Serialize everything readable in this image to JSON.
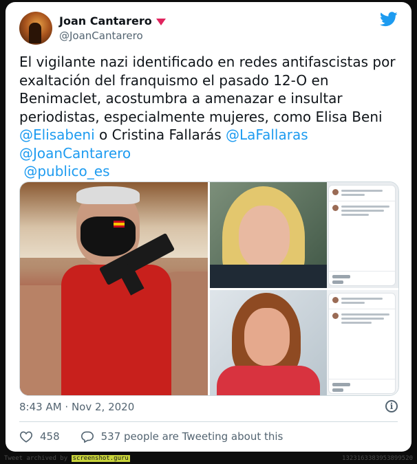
{
  "tweet": {
    "author_name": "Joan Cantarero",
    "author_handle": "@JoanCantarero",
    "text_plain": "El vigilante nazi identificado en redes antifascistas por exaltación del franquismo el pasado 12-O en Benimaclet, acostumbra a amenazar e insultar periodistas, especialmente mujeres, como Elisa Beni ",
    "mention_1": "@Elisabeni",
    "text_mid": " o Cristina Fallarás ",
    "mention_2": "@LaFallaras",
    "mention_3": "@JoanCantarero",
    "mention_4": "@publico_es",
    "timestamp": "8:43 AM · Nov 2, 2020",
    "likes": "458",
    "replies_label": "537 people are Tweeting about this"
  },
  "footer": {
    "archived_prefix": "Tweet archived by",
    "brand": "screenshot.guru",
    "id": "1323163383953899520"
  },
  "icons": {
    "platform": "twitter-bird-icon",
    "info": "info-icon",
    "like": "heart-icon",
    "reply": "comment-bubble-icon"
  },
  "colors": {
    "link": "#1d9bf0",
    "text": "#0f1419",
    "muted": "#536471",
    "brand_badge": "#e0245e"
  }
}
